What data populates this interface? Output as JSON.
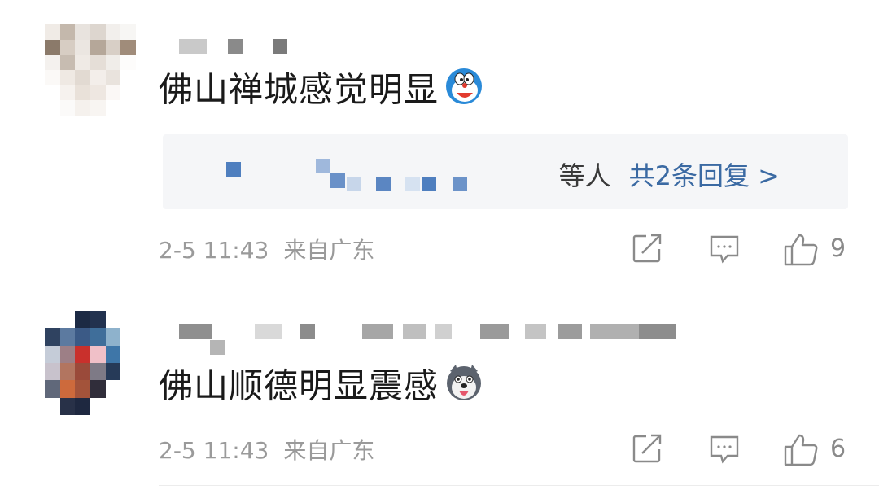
{
  "comments": [
    {
      "text": "佛山禅城感觉明显",
      "emoji": "doraemon-emoji",
      "replies": {
        "suffix": "等人",
        "link": "共2条回复 >"
      },
      "meta": {
        "date": "2-5 11:43",
        "location": "来自广东"
      },
      "likes": "9"
    },
    {
      "text": "佛山顺德明显震感",
      "emoji": "husky-emoji",
      "meta": {
        "date": "2-5 11:43",
        "location": "来自广东"
      },
      "likes": "6"
    }
  ],
  "icons": {
    "share": "share-icon",
    "comment": "comment-icon",
    "like": "thumbs-up-icon"
  },
  "colors": {
    "text": "#1a1a1a",
    "meta": "#9a9a9a",
    "link": "#3b6aa3",
    "reply_bg": "#f5f6f8"
  }
}
